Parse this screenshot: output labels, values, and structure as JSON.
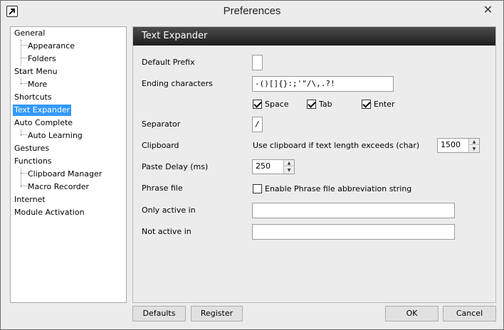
{
  "window": {
    "title": "Preferences",
    "close_symbol": "✕"
  },
  "tree": {
    "items": [
      {
        "label": "General",
        "level": 0
      },
      {
        "label": "Appearance",
        "level": 1
      },
      {
        "label": "Folders",
        "level": 1
      },
      {
        "label": "Start Menu",
        "level": 0
      },
      {
        "label": "More",
        "level": 1
      },
      {
        "label": "Shortcuts",
        "level": 0
      },
      {
        "label": "Text Expander",
        "level": 0,
        "selected": true
      },
      {
        "label": "Auto Complete",
        "level": 0
      },
      {
        "label": "Auto Learning",
        "level": 1
      },
      {
        "label": "Gestures",
        "level": 0
      },
      {
        "label": "Functions",
        "level": 0
      },
      {
        "label": "Clipboard Manager",
        "level": 1
      },
      {
        "label": "Macro Recorder",
        "level": 1
      },
      {
        "label": "Internet",
        "level": 0
      },
      {
        "label": "Module Activation",
        "level": 0
      }
    ]
  },
  "panel": {
    "header": "Text Expander",
    "default_prefix": {
      "label": "Default Prefix",
      "value": ""
    },
    "ending_characters": {
      "label": "Ending characters",
      "value": "-()[]{}:;'\"/\\,.?!"
    },
    "options": {
      "space": "Space",
      "tab": "Tab",
      "enter": "Enter"
    },
    "separator": {
      "label": "Separator",
      "value": "/"
    },
    "clipboard": {
      "label": "Clipboard",
      "text": "Use clipboard if text length exceeds (char)",
      "value": "1500"
    },
    "paste_delay": {
      "label": "Paste Delay (ms)",
      "value": "250"
    },
    "phrase_file": {
      "label": "Phrase file",
      "checkbox": "Enable Phrase file abbreviation string"
    },
    "only_active": {
      "label": "Only active in",
      "value": ""
    },
    "not_active": {
      "label": "Not active in",
      "value": ""
    }
  },
  "buttons": {
    "defaults": "Defaults",
    "register": "Register",
    "ok": "OK",
    "cancel": "Cancel"
  }
}
